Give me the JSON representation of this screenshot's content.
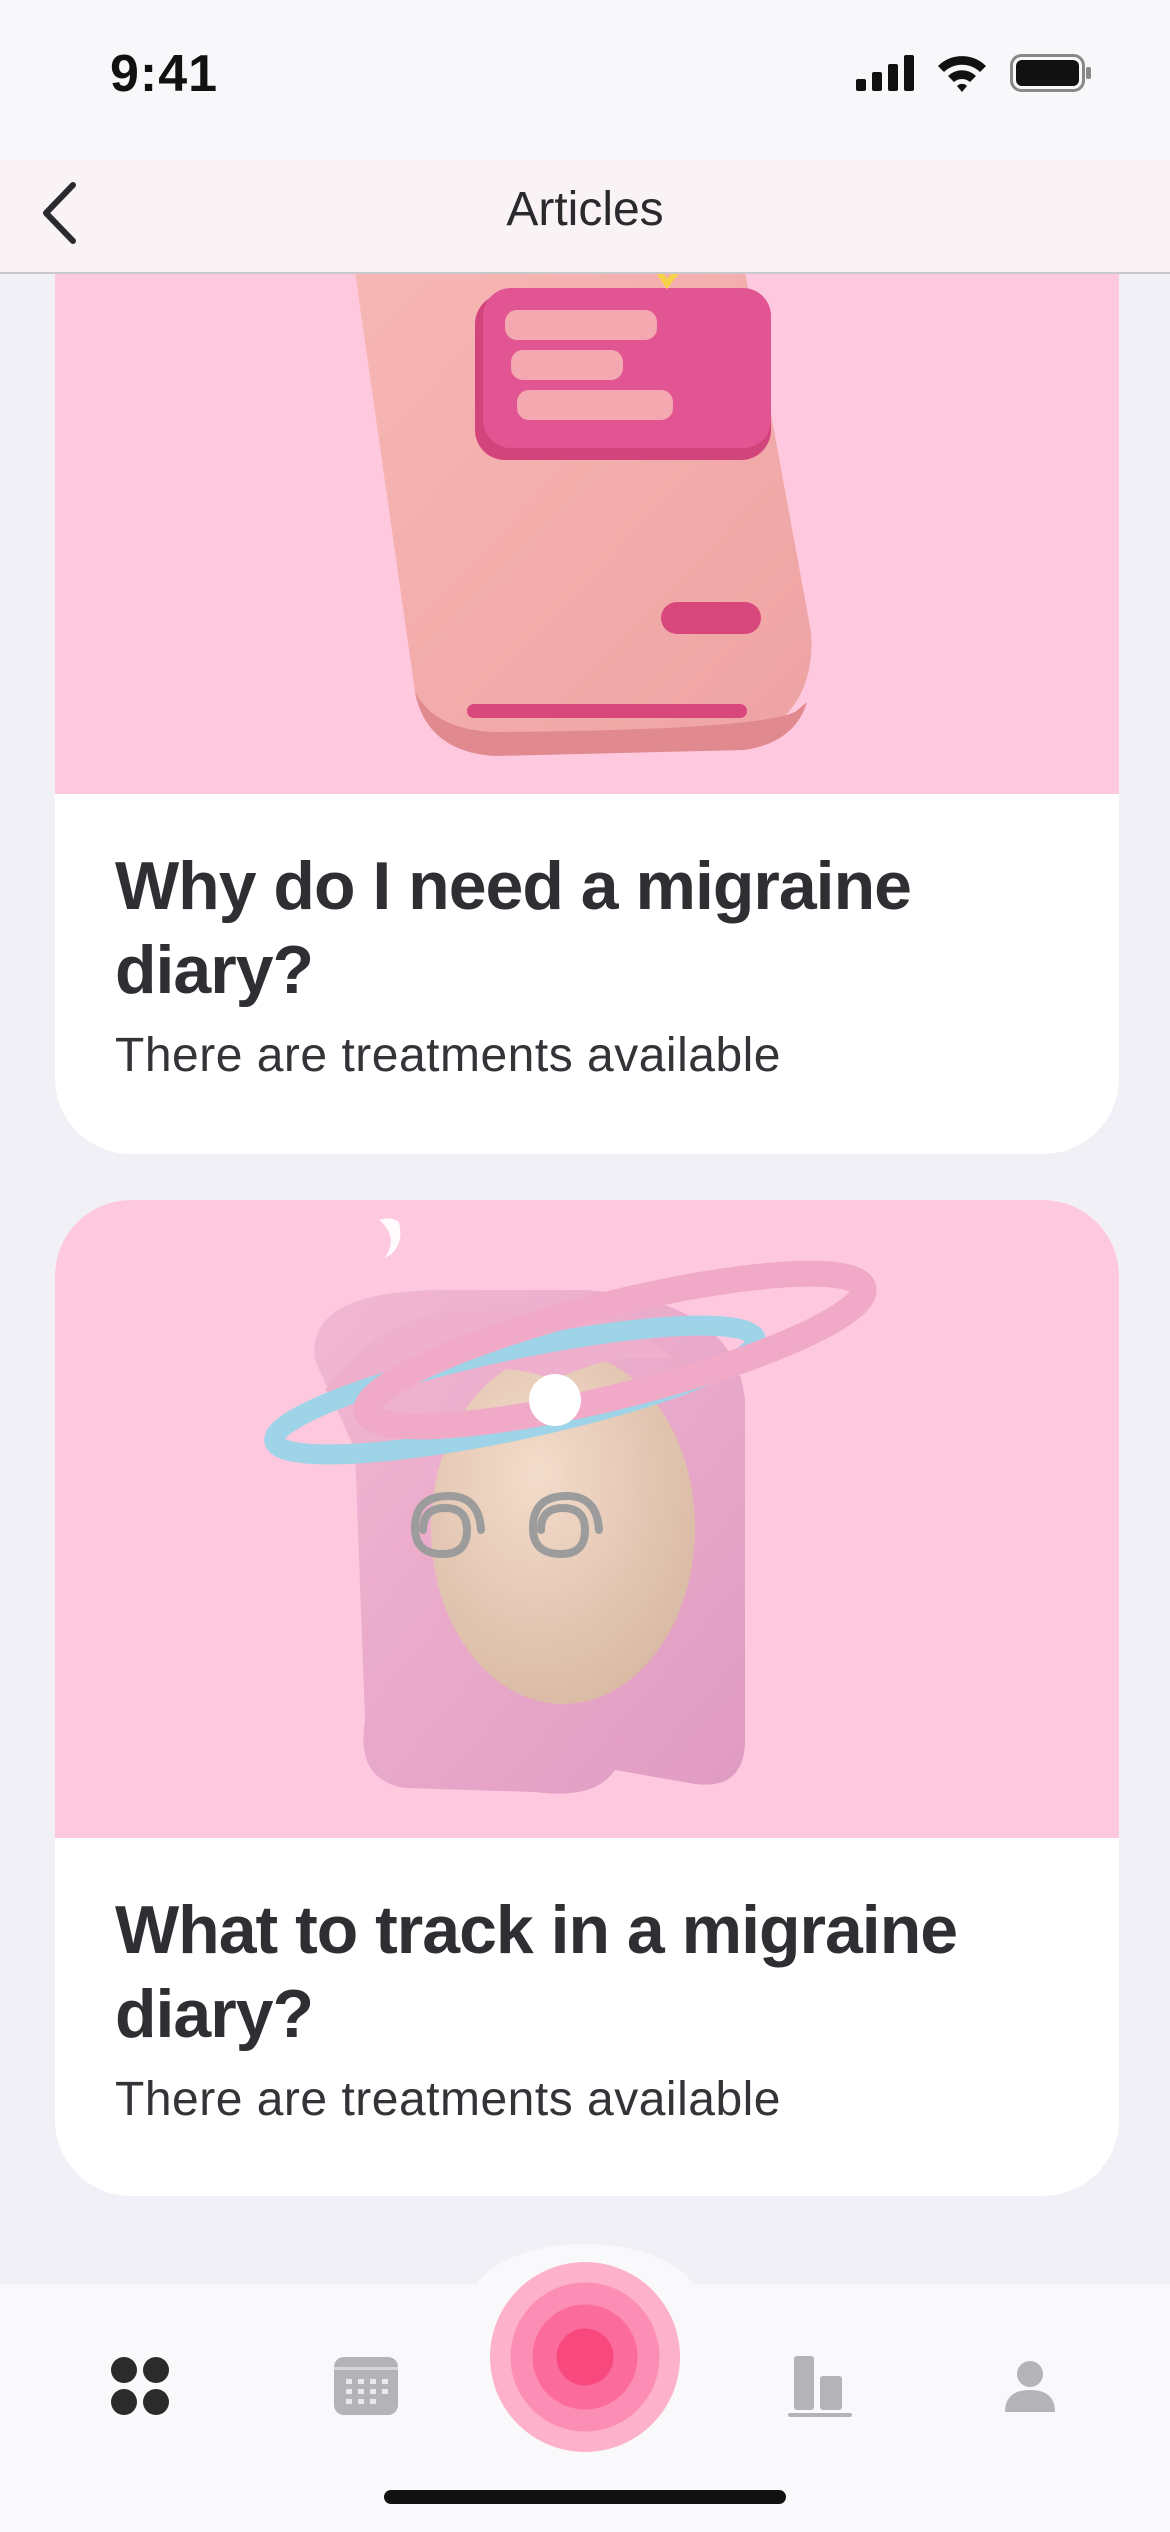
{
  "status_bar": {
    "time": "9:41",
    "icons": [
      "cellular-signal-icon",
      "wifi-icon",
      "battery-icon"
    ]
  },
  "nav": {
    "back_icon": "chevron-left-icon",
    "title": "Articles"
  },
  "articles": [
    {
      "image": "pink-diary-book-illustration",
      "title": "Why do I need a migraine diary?",
      "subtitle": "There are treatments available"
    },
    {
      "image": "dizzy-girl-with-halo-illustration",
      "title": "What to track in a migraine diary?",
      "subtitle": "There are treatments available"
    }
  ],
  "tab_bar": {
    "items": [
      {
        "icon": "home-dots-icon",
        "active": true
      },
      {
        "icon": "calendar-icon",
        "active": false
      },
      {
        "icon": "record-attack-icon",
        "active": false
      },
      {
        "icon": "bar-chart-icon",
        "active": false
      },
      {
        "icon": "profile-icon",
        "active": false
      }
    ]
  },
  "colors": {
    "background": "#f1f0f6",
    "card_image_bg": "#fec9df",
    "accent_pink": "#f8497f",
    "active_tab": "#2b2b2b",
    "inactive_tab": "#b4b4b8"
  }
}
